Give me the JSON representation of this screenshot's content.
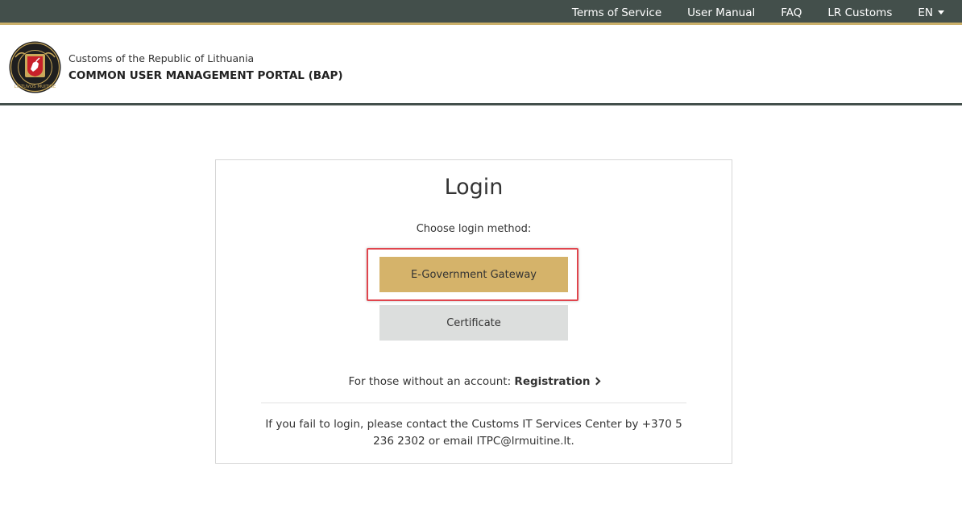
{
  "topnav": {
    "terms": "Terms of Service",
    "manual": "User Manual",
    "faq": "FAQ",
    "customs": "LR Customs",
    "language": "EN"
  },
  "header": {
    "organization": "Customs of the Republic of Lithuania",
    "portal_title": "COMMON USER MANAGEMENT PORTAL (BAP)",
    "logo_text": "LIETUVOS MUITINĖ"
  },
  "login": {
    "title": "Login",
    "choose_label": "Choose login method:",
    "egov_button": "E-Government Gateway",
    "certificate_button": "Certificate",
    "no_account_text": "For those without an account: ",
    "registration_link": "Registration",
    "help_text": "If you fail to login, please contact the Customs IT Services Center by +370 5 236 2302 or email ITPC@lrmuitine.lt."
  },
  "colors": {
    "topbar": "#434f4b",
    "accent_gold": "#cbb06a",
    "primary_button": "#d5b36a",
    "secondary_button": "#dcdedd",
    "highlight_border": "#e0454d"
  }
}
